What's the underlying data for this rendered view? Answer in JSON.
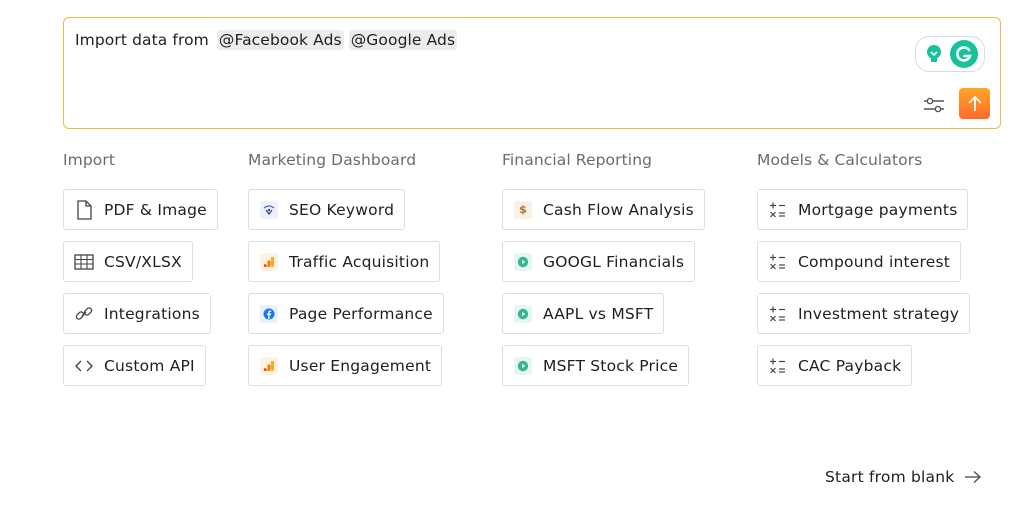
{
  "prompt": {
    "lead_text": "Import data from",
    "mentions": [
      "@Facebook Ads",
      "@Google Ads"
    ]
  },
  "columns": [
    {
      "title": "Import",
      "items": [
        {
          "label": "PDF & Image",
          "icon": "document-icon"
        },
        {
          "label": "CSV/XLSX",
          "icon": "table-icon"
        },
        {
          "label": "Integrations",
          "icon": "link-icon"
        },
        {
          "label": "Custom API",
          "icon": "code-icon"
        }
      ]
    },
    {
      "title": "Marketing Dashboard",
      "items": [
        {
          "label": "SEO Keyword",
          "icon": "seo-icon"
        },
        {
          "label": "Traffic Acquisition",
          "icon": "analytics-icon"
        },
        {
          "label": "Page Performance",
          "icon": "facebook-icon"
        },
        {
          "label": "User Engagement",
          "icon": "analytics-icon"
        }
      ]
    },
    {
      "title": "Financial Reporting",
      "items": [
        {
          "label": "Cash Flow Analysis",
          "icon": "dollar-icon"
        },
        {
          "label": "GOOGL Financials",
          "icon": "play-icon"
        },
        {
          "label": "AAPL vs MSFT",
          "icon": "play-icon"
        },
        {
          "label": "MSFT Stock Price",
          "icon": "play-icon"
        }
      ]
    },
    {
      "title": "Models & Calculators",
      "items": [
        {
          "label": "Mortgage payments",
          "icon": "calculator-icon"
        },
        {
          "label": "Compound interest",
          "icon": "calculator-icon"
        },
        {
          "label": "Investment strategy",
          "icon": "calculator-icon"
        },
        {
          "label": "CAC Payback",
          "icon": "calculator-icon"
        }
      ]
    }
  ],
  "start_from_blank": "Start from blank",
  "colors": {
    "accent_border": "#f2b84b",
    "send_gradient_top": "#ffa528",
    "send_gradient_bottom": "#ff6a2a",
    "grammarly_green": "#15c39a"
  }
}
